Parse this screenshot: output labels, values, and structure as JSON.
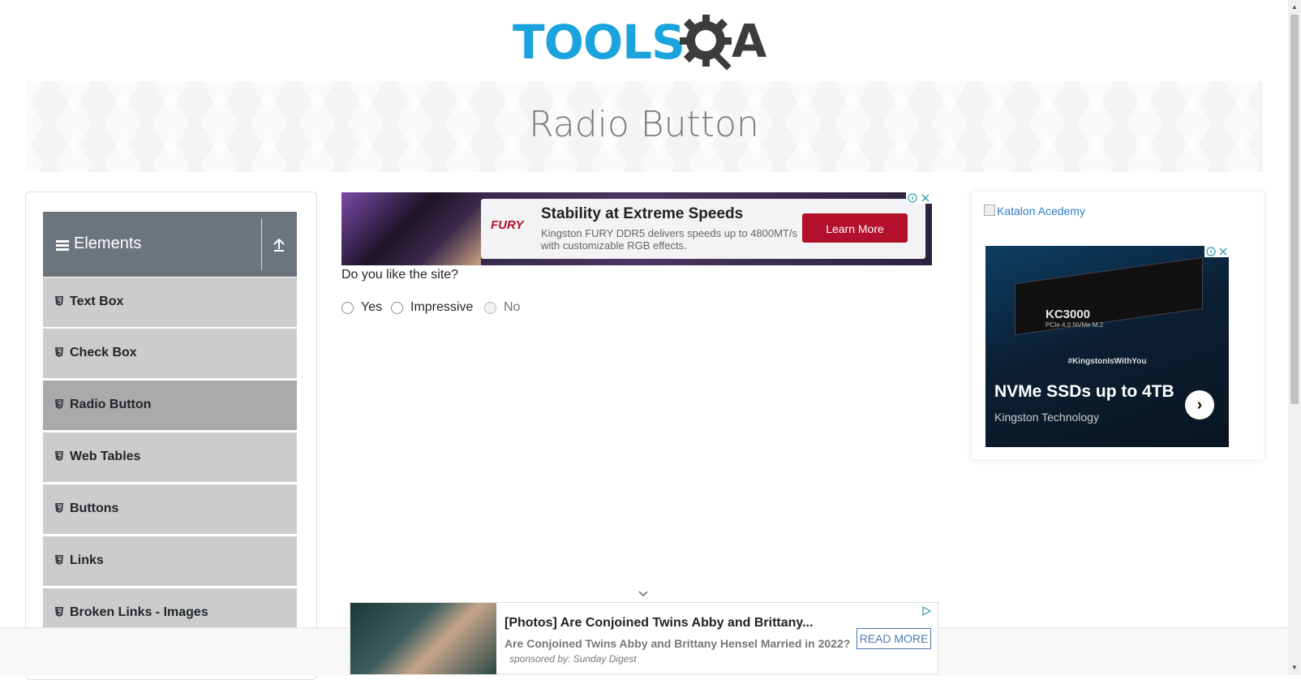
{
  "logo": {
    "tools": "TOOLS",
    "qa_a": "A"
  },
  "banner": {
    "title": "Radio Button"
  },
  "sidebar": {
    "group_title": "Elements",
    "items": [
      {
        "label": "Text Box"
      },
      {
        "label": "Check Box"
      },
      {
        "label": "Radio Button",
        "active": true
      },
      {
        "label": "Web Tables"
      },
      {
        "label": "Buttons"
      },
      {
        "label": "Links"
      },
      {
        "label": "Broken Links - Images"
      }
    ]
  },
  "top_ad": {
    "brand": "FURY",
    "headline": "Stability at Extreme Speeds",
    "description": "Kingston FURY DDR5 delivers speeds up to 4800MT/s with customizable RGB effects.",
    "cta": "Learn More"
  },
  "main": {
    "question": "Do you like the site?",
    "options": [
      {
        "label": "Yes",
        "disabled": false
      },
      {
        "label": "Impressive",
        "disabled": false
      },
      {
        "label": "No",
        "disabled": true
      }
    ]
  },
  "side_ad": {
    "broken_image_alt": "Katalon Acedemy",
    "product": "KC3000",
    "product_sub": "PCIe 4.0 NVMe M.2",
    "hashtag": "#KingstonIsWithYou",
    "headline": "NVMe SSDs up to 4TB",
    "advertiser": "Kingston Technology"
  },
  "bottom_ad": {
    "headline": "[Photos] Are Conjoined Twins Abby and Brittany...",
    "description": "Are Conjoined Twins Abby and Brittany Hensel Married in 2022?",
    "sponsor": "sponsored by: Sunday Digest",
    "cta": "READ MORE"
  },
  "colors": {
    "brand_blue": "#1aa3dd",
    "menu_header": "#6c757d",
    "menu_item": "#cccccc",
    "ad_red": "#b3102b"
  }
}
